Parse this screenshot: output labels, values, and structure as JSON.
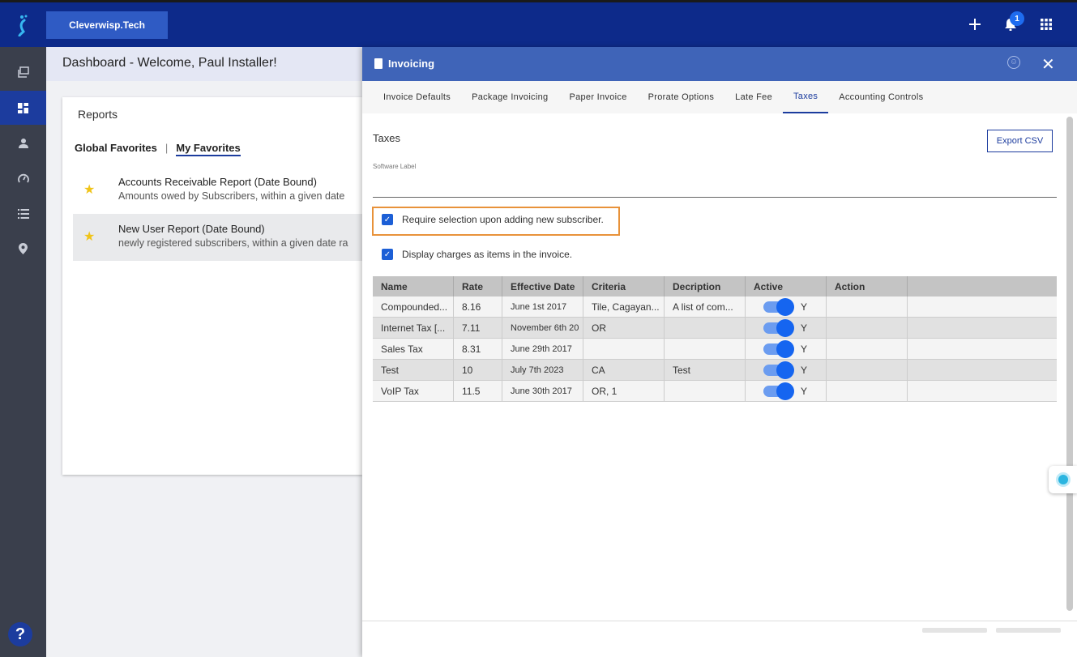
{
  "topbar": {
    "brand": "Cleverwisp.Tech",
    "notification_count": "1",
    "icons": [
      "logo-icon",
      "plus-icon",
      "bell-icon",
      "apps-grid-icon"
    ]
  },
  "sidebar": {
    "items": [
      "gallery-icon",
      "dashboard-icon",
      "person-icon",
      "speed-icon",
      "list-icon",
      "location-icon"
    ],
    "help": "?"
  },
  "dashboard": {
    "header": "Dashboard - Welcome, Paul Installer!",
    "reports_title": "Reports",
    "tab_global": "Global Favorites",
    "tab_sep": "|",
    "tab_mine": "My Favorites",
    "reports": [
      {
        "title": "Accounts Receivable Report (Date Bound)",
        "subtitle": "Amounts owed by Subscribers, within a given date"
      },
      {
        "title": "New User Report (Date Bound)",
        "subtitle": "newly registered subscribers, within a given date ra"
      }
    ]
  },
  "panel": {
    "title": "Invoicing",
    "tabs": [
      "Invoice Defaults",
      "Package Invoicing",
      "Paper Invoice",
      "Prorate Options",
      "Late Fee",
      "Taxes",
      "Accounting Controls"
    ],
    "active_tab": "Taxes",
    "section_title": "Taxes",
    "export_label": "Export CSV",
    "software_label": "Software Label",
    "check1": "Require selection upon adding new subscriber.",
    "check2": "Display charges as items in the invoice.",
    "columns": [
      "Name",
      "Rate",
      "Effective Date",
      "Criteria",
      "Decription",
      "Active",
      "Action"
    ],
    "rows": [
      {
        "name": "Compounded...",
        "rate": "8.16",
        "date": "June 1st 2017",
        "criteria": "Tile, Cagayan...",
        "desc": "A list of com...",
        "active": "Y"
      },
      {
        "name": "Internet Tax [...",
        "rate": "7.11",
        "date": "November 6th 20",
        "criteria": "OR",
        "desc": "",
        "active": "Y"
      },
      {
        "name": "Sales Tax",
        "rate": "8.31",
        "date": "June 29th 2017",
        "criteria": "",
        "desc": "",
        "active": "Y"
      },
      {
        "name": "Test",
        "rate": "10",
        "date": "July 7th 2023",
        "criteria": "CA",
        "desc": "Test",
        "active": "Y"
      },
      {
        "name": "VoIP Tax",
        "rate": "11.5",
        "date": "June 30th 2017",
        "criteria": "OR, 1",
        "desc": "",
        "active": "Y"
      }
    ]
  },
  "colors": {
    "topbar": "#0d2a8a",
    "accent": "#1c3c9e",
    "highlight_border": "#e8923a",
    "toggle": "#1565f0"
  }
}
